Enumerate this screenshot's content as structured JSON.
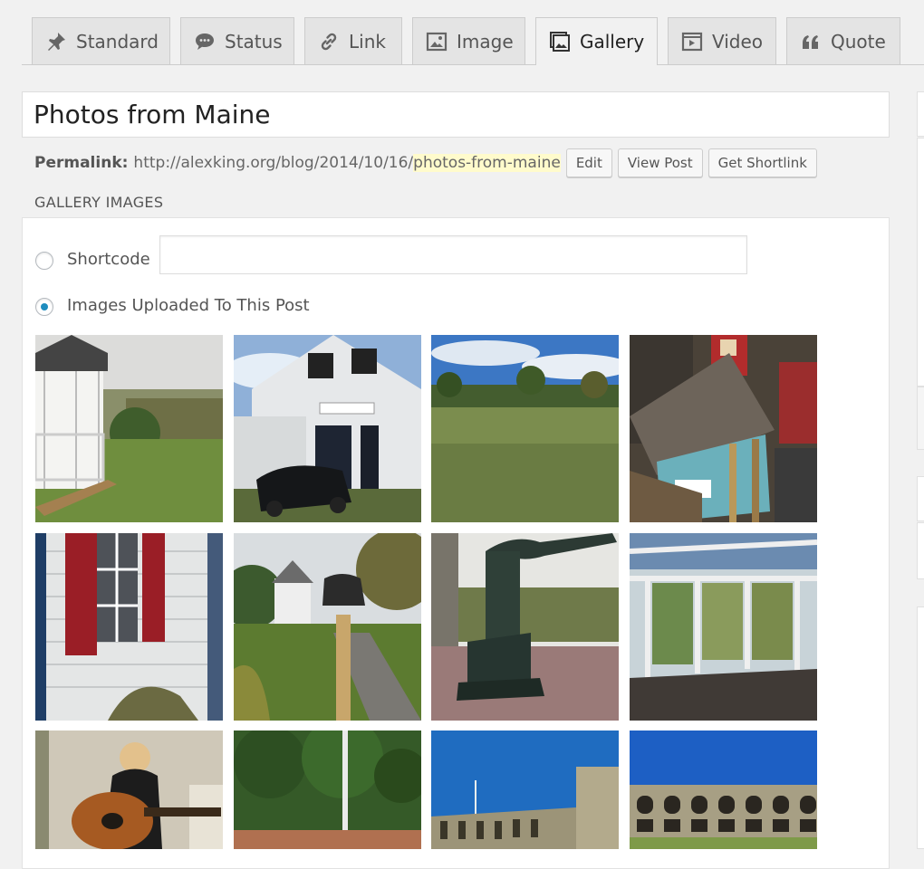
{
  "tabs": [
    {
      "label": "Standard",
      "icon": "pin-icon",
      "active": false
    },
    {
      "label": "Status",
      "icon": "speech-bubble-icon",
      "active": false
    },
    {
      "label": "Link",
      "icon": "link-icon",
      "active": false
    },
    {
      "label": "Image",
      "icon": "image-icon",
      "active": false
    },
    {
      "label": "Gallery",
      "icon": "gallery-icon",
      "active": true
    },
    {
      "label": "Video",
      "icon": "video-icon",
      "active": false
    },
    {
      "label": "Quote",
      "icon": "quote-icon",
      "active": false
    }
  ],
  "post": {
    "title": "Photos from Maine",
    "permalink_label": "Permalink:",
    "permalink_base": "http://alexking.org/blog/2014/10/16/",
    "permalink_slug": "photos-from-maine",
    "edit_label": "Edit",
    "view_label": "View Post",
    "shortlink_label": "Get Shortlink"
  },
  "gallery": {
    "heading": "GALLERY IMAGES",
    "shortcode_label": "Shortcode",
    "shortcode_value": "",
    "uploaded_label": "Images Uploaded To This Post",
    "selected": "uploaded",
    "images": [
      "gazebo-photo",
      "white-barn-photo",
      "field-photo",
      "birdhouse-photo",
      "red-shutter-window-photo",
      "bell-post-photo",
      "water-pump-photo",
      "sunroom-photo",
      "guitar-player-photo",
      "trees-photo",
      "fort-wall-photo",
      "fort-arches-photo"
    ]
  },
  "colors": {
    "accent": "#1e8cbe",
    "slug_highlight": "#fffbcc"
  }
}
